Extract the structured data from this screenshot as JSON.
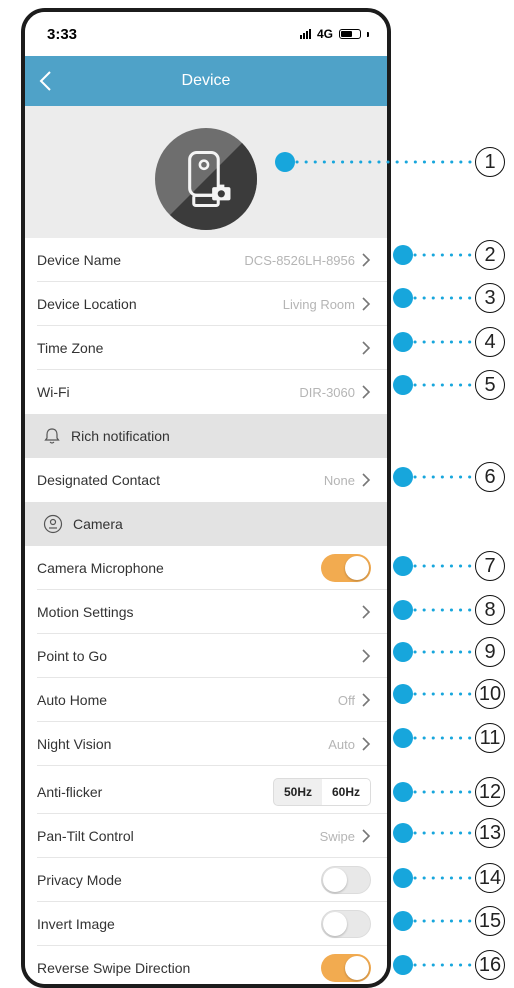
{
  "status": {
    "time": "3:33",
    "network": "4G"
  },
  "nav": {
    "title": "Device"
  },
  "rows": {
    "device_name": {
      "label": "Device Name",
      "value": "DCS-8526LH-8956"
    },
    "device_location": {
      "label": "Device Location",
      "value": "Living Room"
    },
    "time_zone": {
      "label": "Time Zone",
      "value": ""
    },
    "wifi": {
      "label": "Wi-Fi",
      "value": "DIR-3060"
    },
    "designated_contact": {
      "label": "Designated Contact",
      "value": "None"
    },
    "camera_microphone": {
      "label": "Camera Microphone",
      "enabled": true
    },
    "motion_settings": {
      "label": "Motion Settings"
    },
    "point_to_go": {
      "label": "Point to Go"
    },
    "auto_home": {
      "label": "Auto Home",
      "value": "Off"
    },
    "night_vision": {
      "label": "Night Vision",
      "value": "Auto"
    },
    "anti_flicker": {
      "label": "Anti-flicker",
      "options": [
        "50Hz",
        "60Hz"
      ],
      "selected": "60Hz"
    },
    "pan_tilt": {
      "label": "Pan-Tilt Control",
      "value": "Swipe"
    },
    "privacy_mode": {
      "label": "Privacy Mode",
      "enabled": false
    },
    "invert_image": {
      "label": "Invert Image",
      "enabled": false
    },
    "reverse_swipe": {
      "label": "Reverse Swipe Direction",
      "enabled": true
    }
  },
  "sections": {
    "rich_notification": {
      "label": "Rich notification"
    },
    "camera": {
      "label": "Camera"
    }
  },
  "callouts": [
    "1",
    "2",
    "3",
    "4",
    "5",
    "6",
    "7",
    "8",
    "9",
    "10",
    "11",
    "12",
    "13",
    "14",
    "15",
    "16"
  ],
  "colors": {
    "nav": "#4fa2c8",
    "toggle_on": "#f2ab50",
    "callout_dot": "#17a6dc"
  }
}
